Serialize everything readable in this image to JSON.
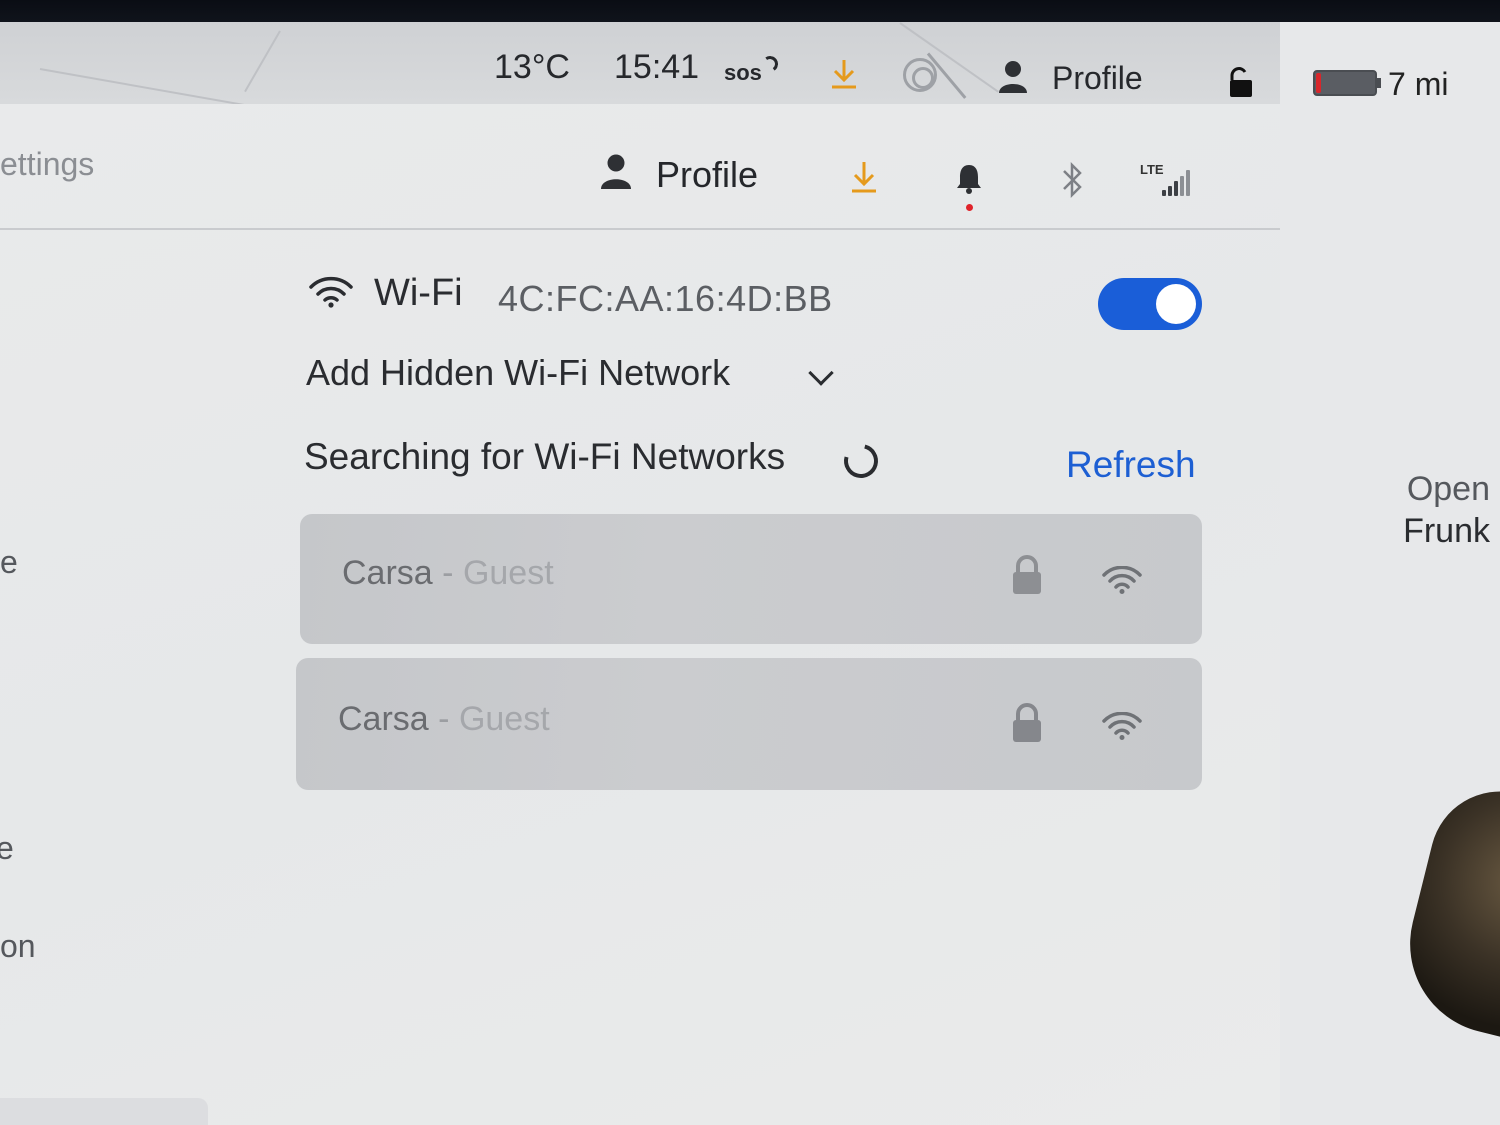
{
  "status_bar": {
    "temperature": "13°C",
    "time": "15:41",
    "sos": "sos",
    "profile": "Profile",
    "range": "7 mi"
  },
  "settings_panel": {
    "title": "ettings",
    "side_labels": [
      "e",
      "e",
      "on"
    ],
    "header": {
      "profile": "Profile",
      "lte": "LTE"
    },
    "wifi": {
      "label": "Wi-Fi",
      "mac": "4C:FC:AA:16:4D:BB",
      "enabled": true
    },
    "add_hidden": "Add Hidden Wi-Fi Network",
    "searching": "Searching for Wi-Fi Networks",
    "refresh": "Refresh",
    "networks": [
      {
        "name": "Carsa",
        "separator": "-",
        "suffix": "Guest",
        "secured": true,
        "icon": "wifi-icon"
      },
      {
        "name": "Carsa",
        "separator": "-",
        "suffix": "Guest",
        "secured": true,
        "icon": "wifi-icon"
      }
    ]
  },
  "side_panel": {
    "frunk_line1": "Open",
    "frunk_line2": "Frunk"
  },
  "colors": {
    "accent": "#1a5ed8",
    "download": "#e59a1c",
    "notification_dot": "#e0232a",
    "battery_low": "#d8262b"
  }
}
